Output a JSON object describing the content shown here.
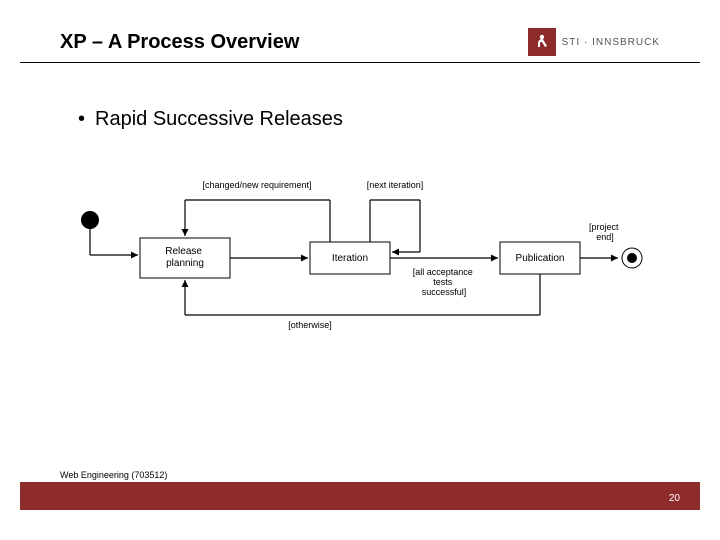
{
  "slide": {
    "title": "XP – A Process Overview",
    "bullet": "Rapid Successive Releases",
    "footer_text": "Web Engineering (703512)",
    "page_number": "20"
  },
  "logo": {
    "brand_a": "STI",
    "brand_b": "INNSBRUCK"
  },
  "diagram": {
    "nodes": {
      "release_planning": "Release\nplanning",
      "iteration": "Iteration",
      "publication": "Publication"
    },
    "labels": {
      "changed_req": "[changed/new requirement]",
      "next_iter": "[next iteration]",
      "project_end": "[project\nend]",
      "tests_ok": "[all acceptance\ntests\nsuccessful]",
      "otherwise": "[otherwise]"
    }
  }
}
